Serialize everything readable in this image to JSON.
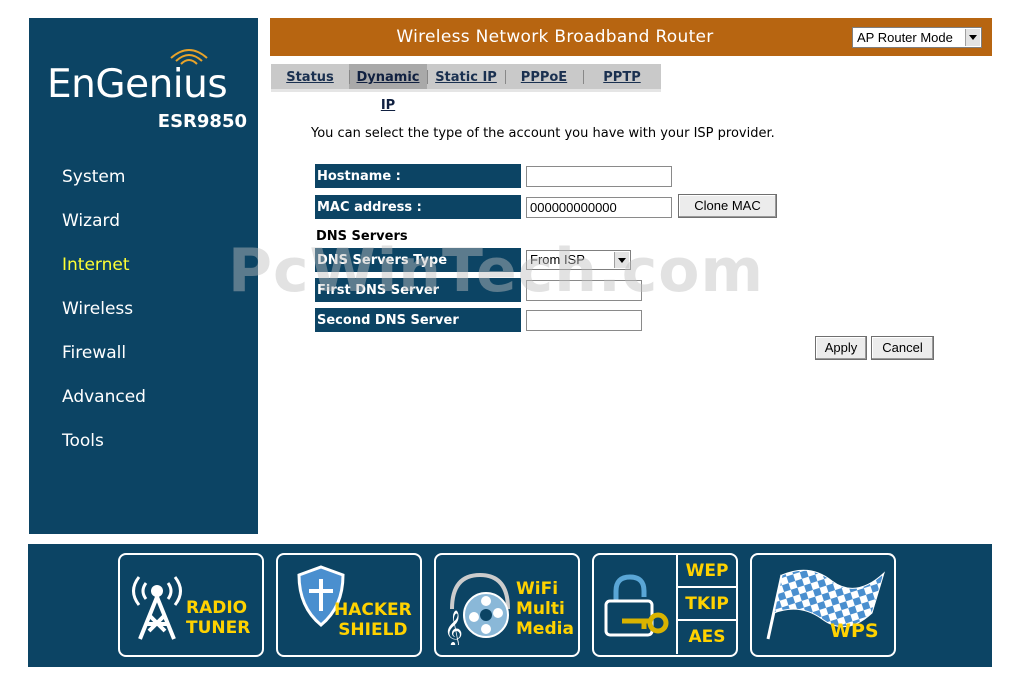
{
  "brand": {
    "name": "EnGenius",
    "model": "ESR9850"
  },
  "header": {
    "title": "Wireless Network Broadband Router",
    "mode": "AP Router Mode"
  },
  "nav": {
    "items": [
      {
        "label": "System"
      },
      {
        "label": "Wizard"
      },
      {
        "label": "Internet",
        "active": true
      },
      {
        "label": "Wireless"
      },
      {
        "label": "Firewall"
      },
      {
        "label": "Advanced"
      },
      {
        "label": "Tools"
      }
    ]
  },
  "tabs": [
    {
      "label": "Status"
    },
    {
      "label": "Dynamic IP",
      "active": true
    },
    {
      "label": "Static IP"
    },
    {
      "label": "PPPoE"
    },
    {
      "label": "PPTP"
    }
  ],
  "content": {
    "intro": "You can select the type of the account you have with your ISP provider.",
    "hostname_label": "Hostname :",
    "hostname_value": "",
    "mac_label": "MAC address :",
    "mac_value": "000000000000",
    "clone_mac_label": "Clone MAC",
    "dns_heading": "DNS Servers",
    "dns_type_label": "DNS Servers Type",
    "dns_type_value": "From ISP",
    "first_dns_label": "First DNS Server",
    "first_dns_value": "",
    "second_dns_label": "Second DNS Server",
    "second_dns_value": "",
    "apply_label": "Apply",
    "cancel_label": "Cancel"
  },
  "watermark": "PcWinTech.com",
  "features": {
    "radio_tuner": [
      "RADIO",
      "TUNER"
    ],
    "hacker_shield": [
      "HACKER",
      "SHIELD"
    ],
    "wifi_multimedia": [
      "WiFi",
      "Multi",
      "Media"
    ],
    "security": [
      "WEP",
      "TKIP",
      "AES"
    ],
    "wps": "WPS"
  },
  "colors": {
    "sidebar_bg": "#0c4464",
    "header_bg": "#b76511",
    "active_nav": "#ffff33",
    "badge_text": "#ffd200"
  }
}
